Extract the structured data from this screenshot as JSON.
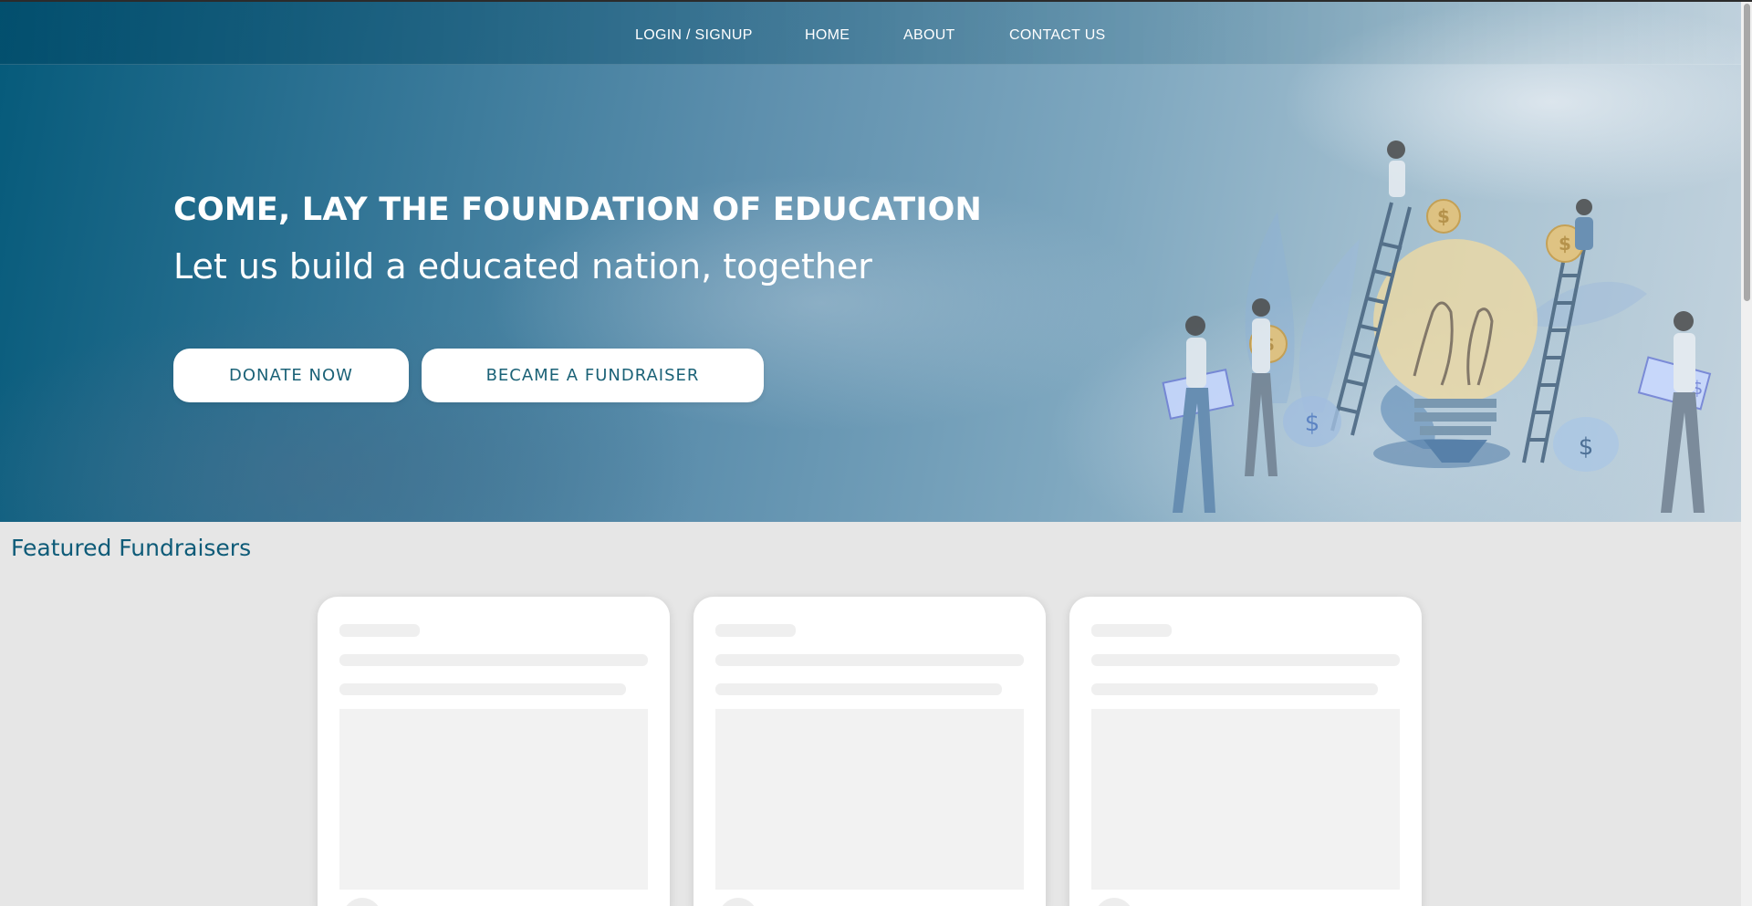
{
  "nav": {
    "items": [
      {
        "label": "LOGIN / SIGNUP"
      },
      {
        "label": "HOME"
      },
      {
        "label": "ABOUT"
      },
      {
        "label": "CONTACT US"
      }
    ]
  },
  "hero": {
    "title": "COME, LAY THE FOUNDATION OF EDUCATION",
    "subtitle": "Let us build a educated nation, together",
    "donate_label": "DONATE NOW",
    "fundraiser_label": "BECAME A FUNDRAISER",
    "illustration_symbol": "$"
  },
  "featured": {
    "title": "Featured Fundraisers",
    "cards": [
      {
        "state": "loading"
      },
      {
        "state": "loading"
      },
      {
        "state": "loading"
      }
    ]
  },
  "colors": {
    "accent": "#0e5b78",
    "button_text": "#1b6277",
    "page_bg": "#e6e6e6",
    "skeleton": "#efefef"
  }
}
